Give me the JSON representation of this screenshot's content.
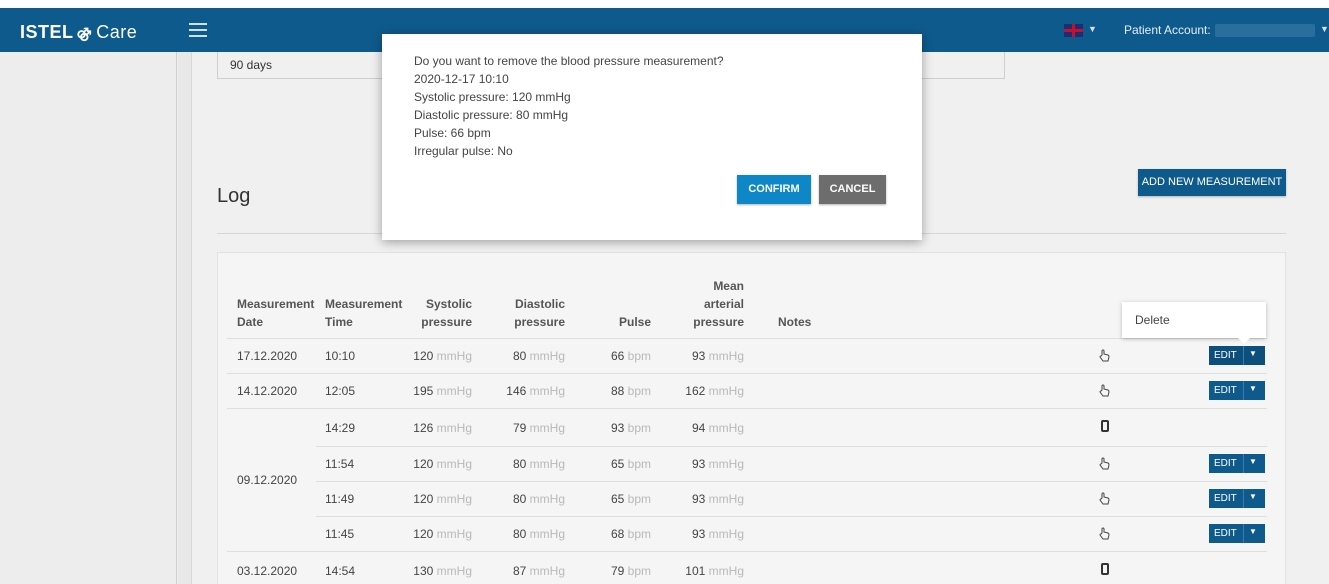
{
  "header": {
    "logo_text": "ISTEL",
    "logo_suffix": "Care",
    "patient_label": "Patient Account:"
  },
  "range": {
    "value": "90 days"
  },
  "log": {
    "title": "Log",
    "add_button": "ADD NEW MEASUREMENT"
  },
  "table": {
    "headers": {
      "date": [
        "Measurement",
        "Date"
      ],
      "time": [
        "Measurement",
        "Time"
      ],
      "systolic": [
        "Systolic",
        "pressure"
      ],
      "diastolic": [
        "Diastolic",
        "pressure"
      ],
      "pulse": [
        "Pulse"
      ],
      "map": [
        "Mean",
        "arterial",
        "pressure"
      ],
      "notes": [
        "Notes"
      ]
    },
    "units": {
      "pressure": "mmHg",
      "pulse": "bpm"
    },
    "edit_label": "EDIT",
    "rows": [
      {
        "date": "17.12.2020",
        "time": "10:10",
        "systolic": "120",
        "diastolic": "80",
        "pulse": "66",
        "map": "93",
        "source": "hand-icon",
        "editable": true
      },
      {
        "date": "14.12.2020",
        "time": "12:05",
        "systolic": "195",
        "diastolic": "146",
        "pulse": "88",
        "map": "162",
        "source": "hand-icon",
        "editable": true
      },
      {
        "date": "",
        "time": "14:29",
        "systolic": "126",
        "diastolic": "79",
        "pulse": "93",
        "map": "94",
        "source": "phone-icon",
        "editable": false
      },
      {
        "date": "09.12.2020",
        "time": "11:54",
        "systolic": "120",
        "diastolic": "80",
        "pulse": "65",
        "map": "93",
        "source": "hand-icon",
        "editable": true
      },
      {
        "date": "",
        "time": "11:49",
        "systolic": "120",
        "diastolic": "80",
        "pulse": "65",
        "map": "93",
        "source": "hand-icon",
        "editable": true
      },
      {
        "date": "",
        "time": "11:45",
        "systolic": "120",
        "diastolic": "80",
        "pulse": "68",
        "map": "93",
        "source": "hand-icon",
        "editable": true
      },
      {
        "date": "03.12.2020",
        "time": "14:54",
        "systolic": "130",
        "diastolic": "87",
        "pulse": "79",
        "map": "101",
        "source": "phone-icon",
        "editable": false
      }
    ]
  },
  "dropdown": {
    "delete_label": "Delete"
  },
  "modal": {
    "question": "Do you want to remove the blood pressure measurement?",
    "datetime": "2020-12-17 10:10",
    "systolic": "Systolic pressure: 120 mmHg",
    "diastolic": "Diastolic pressure: 80 mmHg",
    "pulse": "Pulse: 66 bpm",
    "irregular": "Irregular pulse: No",
    "confirm_label": "CONFIRM",
    "cancel_label": "CANCEL"
  },
  "colors": {
    "brand": "#0f5a8c",
    "confirm": "#0d87c8",
    "cancel": "#6d6d6d"
  }
}
